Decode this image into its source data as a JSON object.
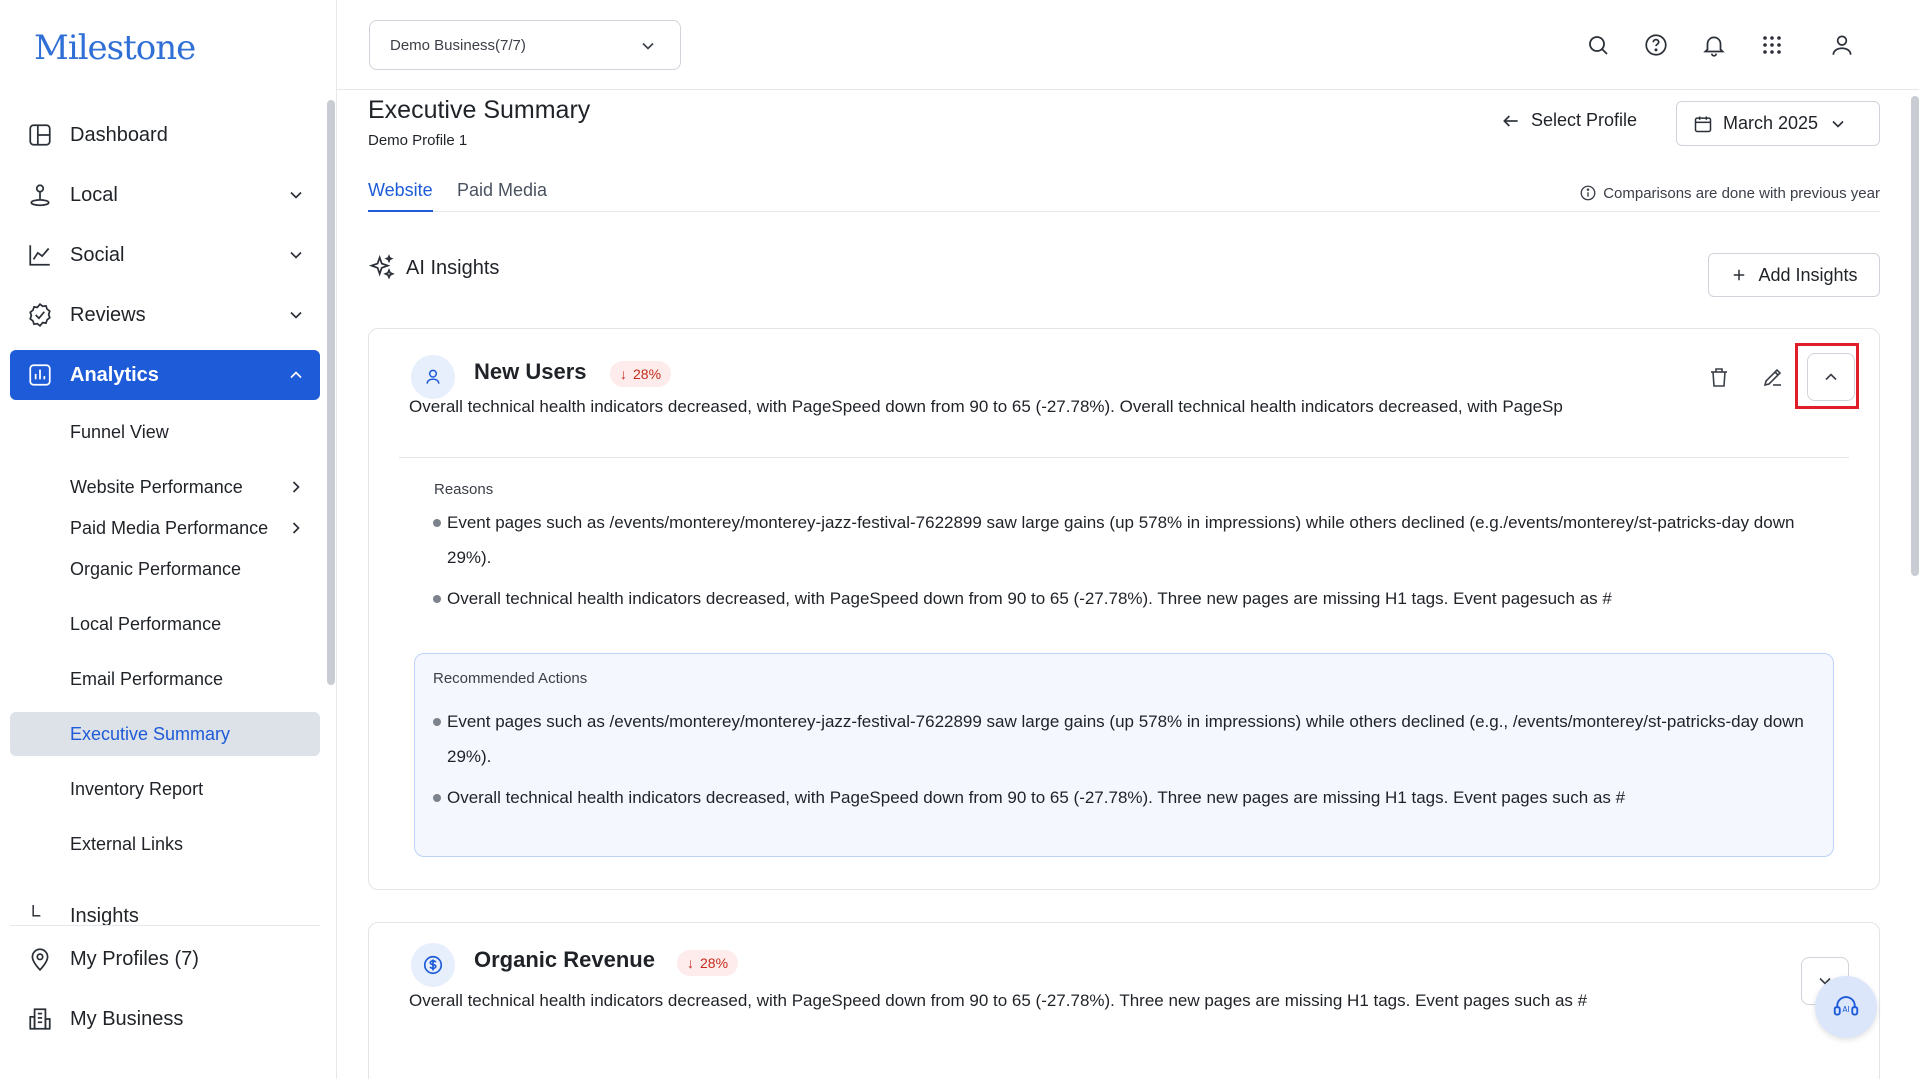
{
  "brand": {
    "logo_text": "Milestone"
  },
  "sidebar": {
    "items": [
      {
        "label": "Dashboard",
        "icon": "dashboard-icon"
      },
      {
        "label": "Local",
        "icon": "local-pin-icon"
      },
      {
        "label": "Social",
        "icon": "chart-line-icon"
      },
      {
        "label": "Reviews",
        "icon": "check-badge-icon"
      },
      {
        "label": "Analytics",
        "icon": "bar-chart-icon",
        "active": true
      }
    ],
    "analytics_sub": [
      {
        "label": "Funnel View"
      },
      {
        "label": "Website Performance"
      },
      {
        "label": "Paid Media Performance"
      },
      {
        "label": "Organic Performance"
      },
      {
        "label": "Local Performance"
      },
      {
        "label": "Email Performance"
      },
      {
        "label": "Executive Summary",
        "selected": true
      },
      {
        "label": "Inventory Report"
      },
      {
        "label": "External Links"
      }
    ],
    "cut_item": "Insights",
    "bottom": [
      {
        "label": "My Profiles (7)"
      },
      {
        "label": "My Business"
      }
    ]
  },
  "header": {
    "business_select": "Demo Business(7/7)"
  },
  "page": {
    "title": "Executive Summary",
    "subtitle": "Demo Profile 1",
    "select_profile": "Select Profile",
    "month": "March 2025",
    "tabs": [
      {
        "label": "Website",
        "active": true
      },
      {
        "label": "Paid Media"
      }
    ],
    "compare_note": "Comparisons are done with previous year",
    "ai_insights": "AI Insights",
    "add_insights": "Add Insights"
  },
  "cards": [
    {
      "title": "New Users",
      "badge": "28%",
      "summary": "Overall technical health indicators decreased, with PageSpeed down from 90 to 65 (-27.78%). Overall technical health indicators decreased, with PageSp",
      "reasons_label": "Reasons",
      "reasons": [
        "Event pages such as /events/monterey/monterey-jazz-festival-7622899 saw large gains (up 578% in impressions) while others declined (e.g./events/monterey/st-patricks-day down 29%).",
        "Overall technical health indicators decreased, with PageSpeed down from 90 to 65 (-27.78%). Three new pages are missing H1 tags. Event pagesuch as #"
      ],
      "reco_label": "Recommended Actions",
      "recommendations": [
        "Event pages such as /events/monterey/monterey-jazz-festival-7622899 saw large gains (up 578% in impressions) while others declined (e.g., /events/monterey/st-patricks-day down 29%).",
        "Overall technical health indicators decreased, with PageSpeed down from 90 to 65 (-27.78%). Three new pages are missing H1 tags. Event pages such as #"
      ]
    },
    {
      "title": "Organic Revenue",
      "badge": "28%",
      "summary": "Overall technical health indicators decreased, with PageSpeed down from 90 to 65 (-27.78%). Three new pages are missing H1 tags. Event pages such as #"
    }
  ],
  "colors": {
    "accent": "#1e5bd8",
    "negative": "#c42b1c",
    "highlight": "#e01e2a"
  }
}
